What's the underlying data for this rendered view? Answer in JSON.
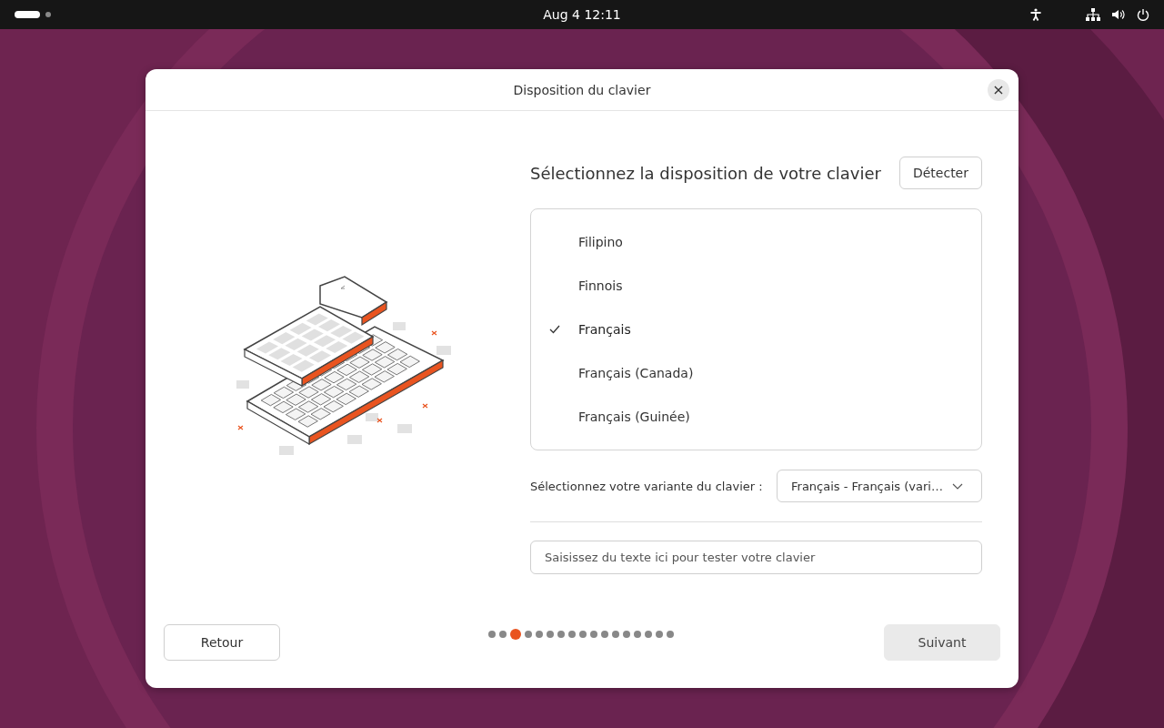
{
  "top_bar": {
    "clock": "Aug 4  12:11"
  },
  "dialog": {
    "title": "Disposition du clavier",
    "close": "×"
  },
  "heading": "Sélectionnez la disposition de votre clavier",
  "detect_button": "Détecter",
  "layouts": [
    {
      "label": "Filipino",
      "selected": false
    },
    {
      "label": "Finnois",
      "selected": false
    },
    {
      "label": "Français",
      "selected": true
    },
    {
      "label": "Français (Canada)",
      "selected": false
    },
    {
      "label": "Français (Guinée)",
      "selected": false
    }
  ],
  "variant": {
    "label": "Sélectionnez votre variante du clavier :",
    "value": "Français - Français (vari…"
  },
  "test_field": {
    "placeholder": "Saisissez du texte ici pour tester votre clavier"
  },
  "back_button": "Retour",
  "next_button": {
    "label": "Suivant",
    "disabled": true
  },
  "steps": [
    {
      "selected": false
    },
    {
      "selected": false
    },
    {
      "selected": true
    },
    {
      "selected": false
    },
    {
      "selected": false
    },
    {
      "selected": false
    },
    {
      "selected": false
    },
    {
      "selected": false
    },
    {
      "selected": false
    },
    {
      "selected": false
    },
    {
      "selected": false
    },
    {
      "selected": false
    },
    {
      "selected": false
    },
    {
      "selected": false
    },
    {
      "selected": false
    },
    {
      "selected": false
    },
    {
      "selected": false
    }
  ]
}
